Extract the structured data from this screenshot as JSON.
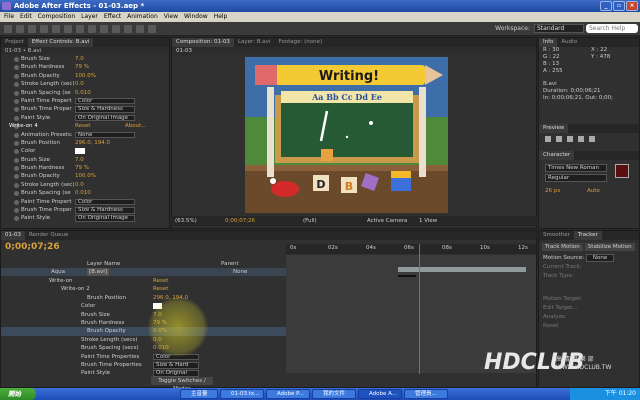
{
  "window": {
    "title": "Adobe After Effects - 01-03.aep *"
  },
  "menu": [
    "File",
    "Edit",
    "Composition",
    "Layer",
    "Effect",
    "Animation",
    "View",
    "Window",
    "Help"
  ],
  "toolbar": {
    "workspace_label": "Workspace:",
    "workspace_value": "Standard",
    "search_placeholder": "Search Help"
  },
  "left_panel": {
    "tabs": [
      "Project",
      "Effect Controls: B.avi"
    ],
    "subheader": "01-03 • B.avi",
    "rows": [
      {
        "name": "Brush Size",
        "value": "7.0"
      },
      {
        "name": "Brush Hardness",
        "value": "79 %"
      },
      {
        "name": "Brush Opacity",
        "value": "100.0%"
      },
      {
        "name": "Stroke Length (sec)",
        "value": "0.0"
      },
      {
        "name": "Brush Spacing (se",
        "value": "0.010"
      },
      {
        "name": "Paint Time Propert",
        "dropdown": "Color"
      },
      {
        "name": "Brush Time Proper",
        "dropdown": "Size & Hardness"
      },
      {
        "name": "Paint Style",
        "dropdown": "On Original Image"
      },
      {
        "header": "Write-on 4",
        "reset": "Reset",
        "about": "About..."
      },
      {
        "name": "Animation Presets:",
        "dropdown": "None"
      },
      {
        "name": "Brush Position",
        "value": "296.0, 194.0"
      },
      {
        "name": "Color"
      },
      {
        "name": "Brush Size",
        "value": "7.0"
      },
      {
        "name": "Brush Hardness",
        "value": "79 %"
      },
      {
        "name": "Brush Opacity",
        "value": "100.0%"
      },
      {
        "name": "Stroke Length (sec)",
        "value": "0.0"
      },
      {
        "name": "Brush Spacing (se",
        "value": "0.010"
      },
      {
        "name": "Paint Time Propert",
        "dropdown": "Color"
      },
      {
        "name": "Brush Time Proper",
        "dropdown": "Size & Hardness"
      },
      {
        "name": "Paint Style",
        "dropdown": "On Original Image"
      }
    ]
  },
  "comp_panel": {
    "tabs": [
      "Composition: 01-03",
      "Layer: B.avi",
      "Footage: (none)"
    ],
    "sub": "01-03",
    "artwork": {
      "sign": "Writing!",
      "banner": "Aa Bb Cc Dd Ee",
      "blocks": [
        "D",
        "B"
      ]
    },
    "controls": {
      "zoom": "(63.5%)",
      "time": "0;00;07;26",
      "res": "(Full)",
      "camera": "Active Camera",
      "view": "1 View"
    }
  },
  "right_panel": {
    "info_tabs": [
      "Info",
      "Audio"
    ],
    "info": {
      "r": "R : 30",
      "g": "G : 22",
      "b": "B : 13",
      "a": "A : 255",
      "x": "X : 22",
      "y": "Y : 478"
    },
    "layer_info": [
      "B.avi",
      "Duration: 0;00;06;21",
      "In: 0;00;06;21, Out: 0;00;"
    ],
    "preview_tab": "Preview",
    "character_tab": "Character",
    "font": "Times New Roman",
    "font_style": "Regular",
    "font_size": "26 px",
    "leading": "Auto"
  },
  "timeline": {
    "tabs": [
      "01-03",
      "Render Queue"
    ],
    "time": "0;00;07;26",
    "columns": {
      "layer_name": "Layer Name",
      "parent": "Parent"
    },
    "layer_row": {
      "name": "Aqua",
      "file": "[B.avi]",
      "parent": "None"
    },
    "ruler_ticks": [
      "0s",
      "02s",
      "04s",
      "06s",
      "08s",
      "10s",
      "12s"
    ],
    "rows": [
      {
        "name": "Write-on",
        "value": "Reset",
        "indent": 48
      },
      {
        "name": "Write-on 2",
        "value": "Reset",
        "indent": 60
      },
      {
        "name": "Brush Position",
        "value": "296.0, 194.0",
        "indent": 86
      },
      {
        "name": "Color",
        "swatch": true,
        "indent": 80
      },
      {
        "name": "Brush Size",
        "value": "7.0",
        "indent": 80
      },
      {
        "name": "Brush Hardness",
        "value": "79 %",
        "indent": 80
      },
      {
        "name": "Brush Opacity",
        "value": "0.0%",
        "indent": 86
      },
      {
        "name": "Stroke Length (secs)",
        "value": "0.0",
        "indent": 80
      },
      {
        "name": "Brush Spacing (secs)",
        "value": "0.010",
        "indent": 80
      },
      {
        "name": "Paint Time Properties",
        "dropdown": "Color",
        "indent": 80
      },
      {
        "name": "Brush Time Properties",
        "dropdown": "Size & Hard",
        "indent": 80
      },
      {
        "name": "Paint Style",
        "dropdown": "On Original",
        "indent": 80
      }
    ],
    "toggle_label": "Toggle Switches / Modes"
  },
  "tracker": {
    "tabs": [
      "Smoother",
      "Tracker"
    ],
    "buttons": [
      "Track Motion",
      "Stabilize Motion"
    ],
    "fields": [
      "Motion Source:",
      "Current Track:",
      "Track Type:",
      "Motion Target:",
      "Edit Target...",
      "Analyze:",
      "Reset"
    ],
    "motion_source": "None"
  },
  "taskbar": {
    "start": "開始",
    "tasks": [
      "主音量",
      "01-03.tx...",
      "Adobe P...",
      "我的文件",
      "Adobe A...",
      "管理員..."
    ],
    "tray": "下午 01:20"
  },
  "watermark": {
    "brand": "HDCLUB",
    "cn": "高 清 俱 樂 部",
    "url": "WWW.HDCLUB.TW"
  }
}
